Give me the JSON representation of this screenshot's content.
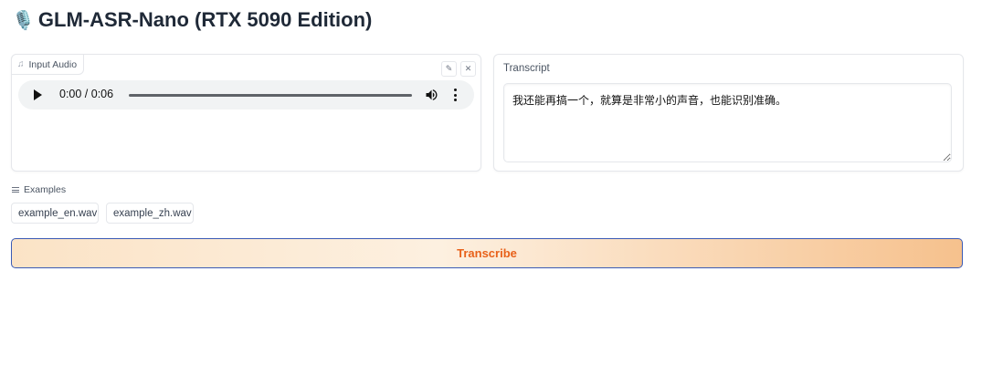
{
  "app": {
    "title": "GLM-ASR-Nano (RTX 5090 Edition)",
    "title_icon": "🎙️"
  },
  "audio_input": {
    "label": "Input Audio",
    "icon": "music-note-icon",
    "edit_icon": "pencil-icon",
    "close_icon": "close-icon",
    "player": {
      "time_display": "0:00 / 0:06",
      "progress": 0
    }
  },
  "transcript": {
    "label": "Transcript",
    "value": "我还能再搞一个，就算是非常小的声音，也能识别准确。"
  },
  "examples": {
    "label": "Examples",
    "items": [
      "example_en.wav",
      "example_zh.wav"
    ]
  },
  "actions": {
    "transcribe_label": "Transcribe"
  },
  "colors": {
    "accent_text": "#e8611a",
    "button_border": "#3b5bb5"
  }
}
